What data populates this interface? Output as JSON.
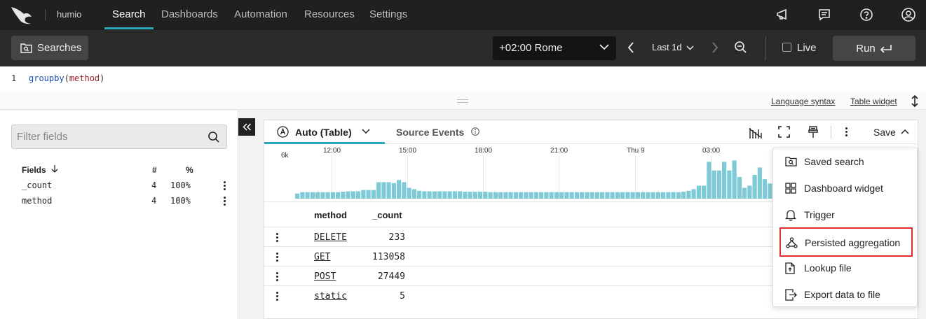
{
  "app": {
    "brand": "humio"
  },
  "nav": {
    "tabs": [
      {
        "label": "Search",
        "active": true
      },
      {
        "label": "Dashboards"
      },
      {
        "label": "Automation"
      },
      {
        "label": "Resources"
      },
      {
        "label": "Settings"
      }
    ],
    "icons": [
      "megaphone-icon",
      "chat-icon",
      "help-icon",
      "user-icon"
    ]
  },
  "toolbar": {
    "searches_label": "Searches",
    "timezone": "+02:00 Rome",
    "time_range": "Last 1d",
    "live_label": "Live",
    "live_checked": false,
    "run_label": "Run"
  },
  "editor": {
    "line_number": "1",
    "query_fn": "groupby",
    "query_open": "(",
    "query_arg": "method",
    "query_close": ")"
  },
  "links": {
    "language_syntax": "Language syntax",
    "table_widget": "Table widget"
  },
  "fields_panel": {
    "filter_placeholder": "Filter fields",
    "headers": {
      "fields": "Fields",
      "count": "#",
      "percent": "%"
    },
    "rows": [
      {
        "name": "_count",
        "count": "4",
        "percent": "100%"
      },
      {
        "name": "method",
        "count": "4",
        "percent": "100%"
      }
    ]
  },
  "results": {
    "tab_auto": "Auto (Table)",
    "tab_source": "Source Events",
    "save_label": "Save",
    "histogram": {
      "ymax_label": "6k",
      "time_ticks": [
        "12:00",
        "15:00",
        "18:00",
        "21:00",
        "Thu 9",
        "03:00"
      ],
      "bars": [
        0.12,
        0.15,
        0.15,
        0.15,
        0.15,
        0.15,
        0.15,
        0.15,
        0.15,
        0.16,
        0.17,
        0.17,
        0.17,
        0.2,
        0.2,
        0.2,
        0.38,
        0.38,
        0.38,
        0.36,
        0.43,
        0.38,
        0.25,
        0.22,
        0.18,
        0.17,
        0.17,
        0.17,
        0.17,
        0.17,
        0.17,
        0.17,
        0.17,
        0.16,
        0.16,
        0.16,
        0.16,
        0.16,
        0.15,
        0.15,
        0.15,
        0.15,
        0.15,
        0.15,
        0.15,
        0.15,
        0.15,
        0.15,
        0.15,
        0.15,
        0.15,
        0.15,
        0.15,
        0.15,
        0.15,
        0.15,
        0.15,
        0.15,
        0.15,
        0.15,
        0.15,
        0.15,
        0.15,
        0.15,
        0.15,
        0.15,
        0.15,
        0.15,
        0.15,
        0.15,
        0.15,
        0.15,
        0.15,
        0.15,
        0.15,
        0.15,
        0.16,
        0.18,
        0.22,
        0.3,
        0.3,
        0.85,
        0.65,
        0.65,
        0.85,
        0.65,
        0.88,
        0.5,
        0.25,
        0.3,
        0.55,
        0.72,
        0.45,
        0.35,
        0.6,
        0.25,
        0.5,
        0.78,
        0.75,
        0.35,
        0.25,
        0.2,
        0.2
      ]
    },
    "table": {
      "headers": [
        "method",
        "_count"
      ],
      "rows": [
        {
          "method": "DELETE",
          "count": "233"
        },
        {
          "method": "GET",
          "count": "113058"
        },
        {
          "method": "POST",
          "count": "27449"
        },
        {
          "method": "static",
          "count": "5"
        }
      ]
    }
  },
  "save_menu": {
    "items": [
      {
        "label": "Saved search",
        "icon": "saved-search-icon"
      },
      {
        "label": "Dashboard widget",
        "icon": "dashboard-widget-icon"
      },
      {
        "label": "Trigger",
        "icon": "bell-icon"
      },
      {
        "label": "Persisted aggregation",
        "icon": "aggregation-icon",
        "highlighted": true
      },
      {
        "label": "Lookup file",
        "icon": "file-icon"
      },
      {
        "label": "Export data to file",
        "icon": "export-file-icon"
      }
    ]
  },
  "colors": {
    "accent": "#2aa7b9",
    "bar": "#7ecad6",
    "highlight_border": "#e0302b",
    "nav_bg": "#202020"
  }
}
